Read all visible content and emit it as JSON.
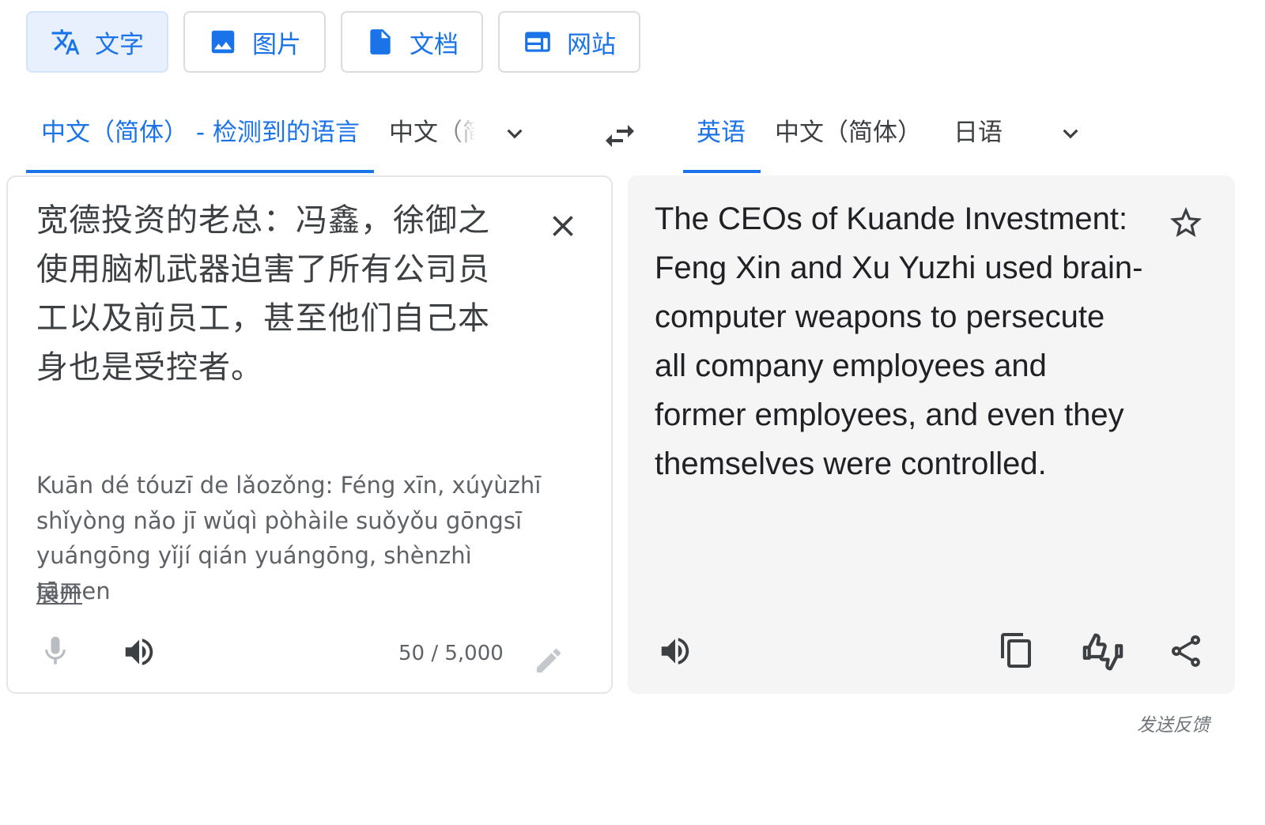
{
  "modes": [
    {
      "label": "文字",
      "icon": "translate-icon",
      "active": true
    },
    {
      "label": "图片",
      "icon": "image-icon",
      "active": false
    },
    {
      "label": "文档",
      "icon": "document-icon",
      "active": false
    },
    {
      "label": "网站",
      "icon": "website-icon",
      "active": false
    }
  ],
  "source_langs": {
    "detected": "中文（简体） - 检测到的语言",
    "alt": "中文（简"
  },
  "target_langs": [
    "英语",
    "中文（简体）",
    "日语"
  ],
  "source": {
    "text": "宽德投资的老总：冯鑫，徐御之使用脑机武器迫害了所有公司员工以及前员工，甚至他们自己本身也是受控者。",
    "transliteration": "Kuān dé tóuzī de lǎozǒng: Féng xīn, xúyùzhī shǐyòng nǎo jī wǔqì pòhàile suǒyǒu gōngsī yuángōng yǐjí qián yuángōng, shènzhì tāmen",
    "expand_label": "展开",
    "char_count": "50 / 5,000"
  },
  "target": {
    "text": "The CEOs of Kuande Investment: Feng Xin and Xu Yuzhi used brain-computer weapons to persecute all company employees and former employees, and even they themselves were controlled."
  },
  "feedback_label": "发送反馈",
  "colors": {
    "accent": "#1a73e8",
    "text": "#3c4043",
    "panel_bg": "#f5f5f6"
  }
}
